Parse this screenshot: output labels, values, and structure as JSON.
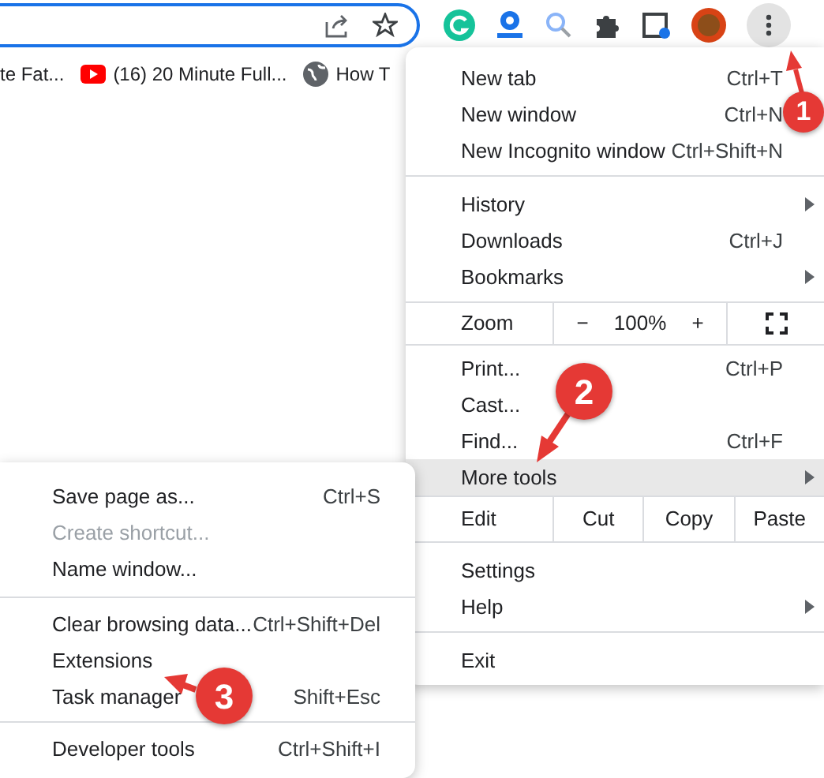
{
  "bookmarks": [
    {
      "label": "te Fat...",
      "kind": "plain"
    },
    {
      "label": "(16) 20 Minute Full...",
      "kind": "video"
    },
    {
      "label": "How T",
      "kind": "web"
    }
  ],
  "menu": {
    "sections": [
      [
        {
          "kind": "item",
          "label": "New tab",
          "shortcut": "Ctrl+T",
          "submenu": false,
          "selected": false
        },
        {
          "kind": "item",
          "label": "New window",
          "shortcut": "Ctrl+N",
          "submenu": false,
          "selected": false
        },
        {
          "kind": "item",
          "label": "New Incognito window",
          "shortcut": "Ctrl+Shift+N",
          "submenu": false,
          "selected": false
        }
      ],
      [
        {
          "kind": "item",
          "label": "History",
          "submenu": true,
          "selected": false
        },
        {
          "kind": "item",
          "label": "Downloads",
          "shortcut": "Ctrl+J",
          "submenu": false,
          "selected": false
        },
        {
          "kind": "item",
          "label": "Bookmarks",
          "submenu": true,
          "selected": false
        }
      ],
      [
        {
          "kind": "zoom",
          "label": "Zoom",
          "minus": "−",
          "value": "100%",
          "plus": "+",
          "selected": false
        }
      ],
      [
        {
          "kind": "item",
          "label": "Print...",
          "shortcut": "Ctrl+P",
          "submenu": false,
          "selected": false
        },
        {
          "kind": "item",
          "label": "Cast...",
          "submenu": false,
          "selected": false
        },
        {
          "kind": "item",
          "label": "Find...",
          "shortcut": "Ctrl+F",
          "submenu": false,
          "selected": false
        },
        {
          "kind": "item",
          "label": "More tools",
          "submenu": true,
          "selected": true
        }
      ],
      [
        {
          "kind": "edit",
          "label": "Edit",
          "buttons": [
            "Cut",
            "Copy",
            "Paste"
          ],
          "selected": false
        }
      ],
      [
        {
          "kind": "item",
          "label": "Settings",
          "submenu": false,
          "selected": false
        },
        {
          "kind": "item",
          "label": "Help",
          "submenu": true,
          "selected": false
        }
      ],
      [
        {
          "kind": "item",
          "label": "Exit",
          "submenu": false,
          "selected": false
        }
      ]
    ]
  },
  "submenu": {
    "sections": [
      [
        {
          "label": "Save page as...",
          "shortcut": "Ctrl+S",
          "disabled": false
        },
        {
          "label": "Create shortcut...",
          "disabled": true
        },
        {
          "label": "Name window...",
          "disabled": false
        }
      ],
      [
        {
          "label": "Clear browsing data...",
          "shortcut": "Ctrl+Shift+Del",
          "disabled": false
        },
        {
          "label": "Extensions",
          "disabled": false
        },
        {
          "label": "Task manager",
          "shortcut": "Shift+Esc",
          "disabled": false
        }
      ],
      [
        {
          "label": "Developer tools",
          "shortcut": "Ctrl+Shift+I",
          "disabled": false
        }
      ]
    ]
  },
  "annotations": [
    {
      "label": "1"
    },
    {
      "label": "2"
    },
    {
      "label": "3"
    }
  ]
}
